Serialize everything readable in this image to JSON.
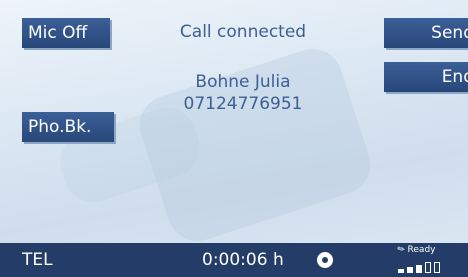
{
  "buttons": {
    "mic_off": "Mic Off",
    "send": "Send",
    "end": "End",
    "phonebook": "Pho.Bk."
  },
  "call": {
    "status": "Call connected",
    "contact_name": "Bohne Julia",
    "number": "07124776951"
  },
  "status_bar": {
    "mode": "TEL",
    "duration": "0:00:06 h",
    "ready_label": "Ready",
    "signal_level": 3,
    "signal_max": 5
  },
  "colors": {
    "button_bg": "#2e4f86",
    "status_bar_bg": "#233c68",
    "text_accent": "#3c5f96"
  },
  "icons": {
    "record": "record-icon",
    "ready": "pen-icon",
    "signal": "signal-strength-icon"
  }
}
